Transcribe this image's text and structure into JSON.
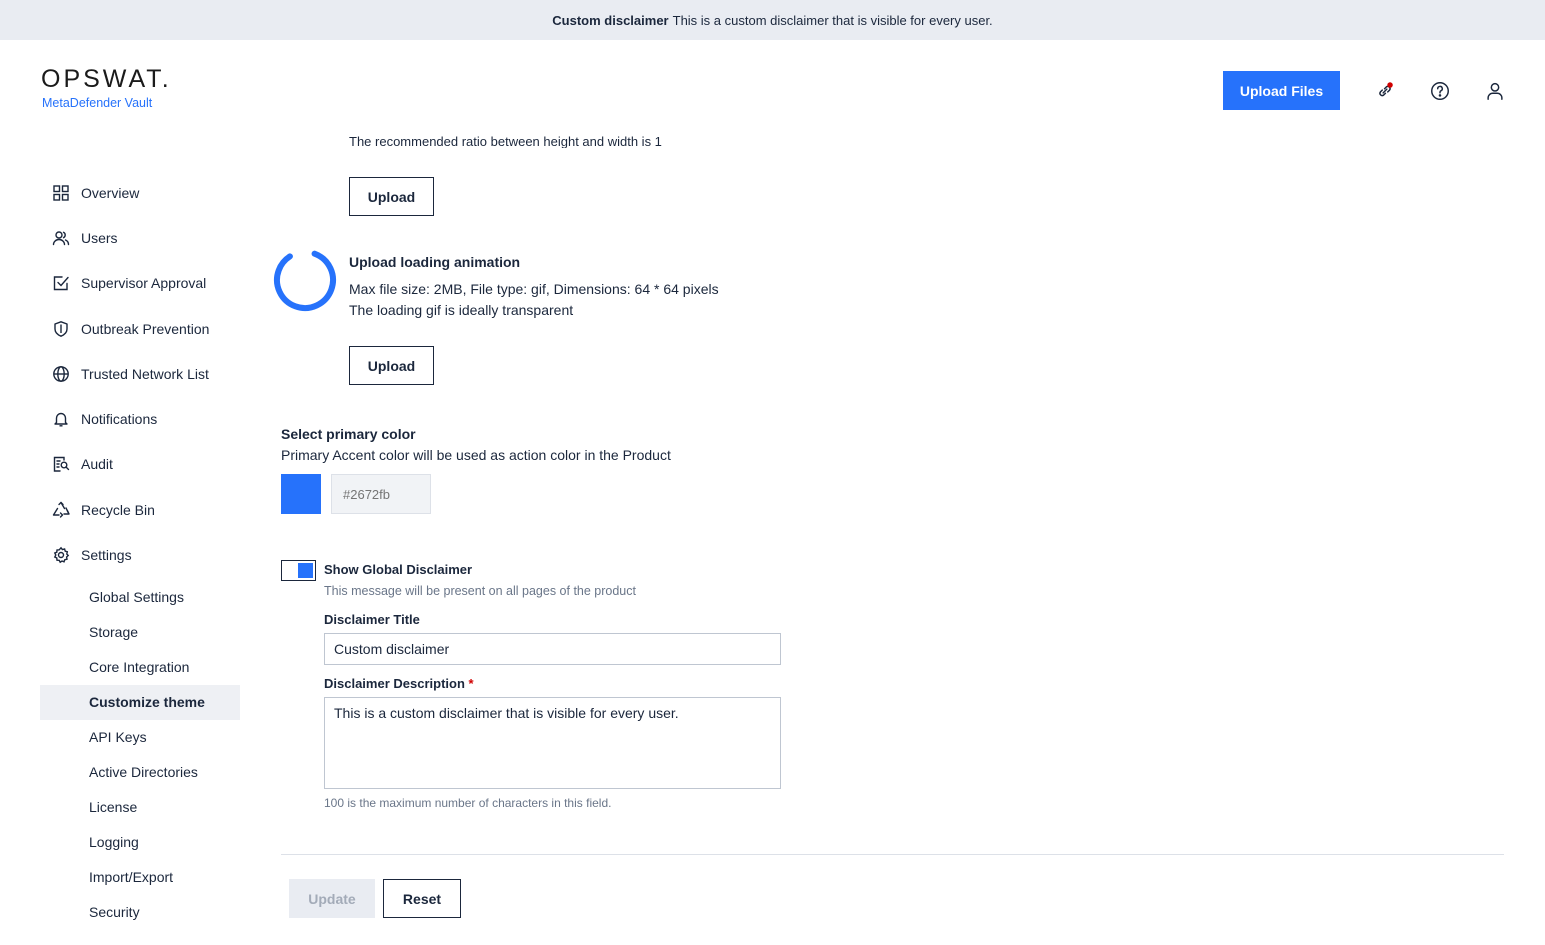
{
  "banner": {
    "title": "Custom disclaimer",
    "text": "This is a custom disclaimer that is visible for every user."
  },
  "header": {
    "brand": "OPSWAT.",
    "product": "MetaDefender Vault",
    "upload_files_label": "Upload Files",
    "icons": [
      "link-notification-icon",
      "help-icon",
      "user-icon"
    ]
  },
  "sidebar": {
    "items": [
      {
        "label": "Overview",
        "icon": "grid-icon"
      },
      {
        "label": "Users",
        "icon": "users-icon"
      },
      {
        "label": "Supervisor Approval",
        "icon": "approval-icon"
      },
      {
        "label": "Outbreak Prevention",
        "icon": "shield-icon"
      },
      {
        "label": "Trusted Network List",
        "icon": "globe-icon"
      },
      {
        "label": "Notifications",
        "icon": "bell-icon"
      },
      {
        "label": "Audit",
        "icon": "audit-icon"
      },
      {
        "label": "Recycle Bin",
        "icon": "recycle-icon"
      },
      {
        "label": "Settings",
        "icon": "gear-icon"
      }
    ],
    "settings_items": [
      "Global Settings",
      "Storage",
      "Core Integration",
      "Customize theme",
      "API Keys",
      "Active Directories",
      "License",
      "Logging",
      "Import/Export",
      "Security"
    ],
    "active_item": "Customize theme"
  },
  "logo_section": {
    "ratio_hint": "The recommended ratio between height and width is 1",
    "upload_label": "Upload"
  },
  "animation_section": {
    "title": "Upload loading animation",
    "spec": "Max file size: 2MB, File type: gif, Dimensions: 64 * 64 pixels",
    "hint": "The loading gif is ideally transparent",
    "upload_label": "Upload"
  },
  "color_section": {
    "title": "Select primary color",
    "description": "Primary Accent color will be used as action color in the Product",
    "value": "#2672fb"
  },
  "disclaimer_section": {
    "toggle_label": "Show Global Disclaimer",
    "toggle_on": true,
    "toggle_hint": "This message will be present on all pages of the product",
    "title_label": "Disclaimer Title",
    "title_value": "Custom disclaimer",
    "description_label": "Disclaimer Description",
    "required_mark": "*",
    "description_value": "This is a custom disclaimer that is visible for every user.",
    "char_hint": "100 is the maximum number of characters in this field."
  },
  "actions": {
    "update_label": "Update",
    "reset_label": "Reset"
  },
  "colors": {
    "accent": "#2672fb",
    "text": "#1b273c",
    "banner_bg": "#e9ecf2",
    "active_bg": "#eef0f4"
  }
}
